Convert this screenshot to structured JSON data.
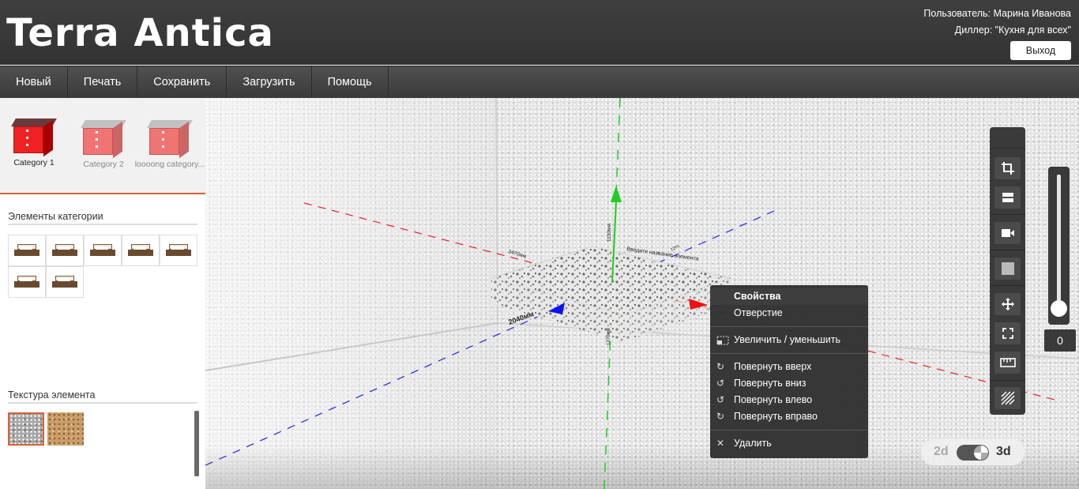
{
  "app": {
    "title": "Terra Antica"
  },
  "header": {
    "user_line": "Пользователь: Марина Иванова",
    "dealer_line": "Диллер: \"Кухня для всех\"",
    "logout_label": "Выход"
  },
  "menu": {
    "items": [
      {
        "label": "Новый"
      },
      {
        "label": "Печать"
      },
      {
        "label": "Сохранить"
      },
      {
        "label": "Загрузить"
      },
      {
        "label": "Помощь"
      }
    ]
  },
  "sidebar": {
    "categories": [
      {
        "label": "Category 1",
        "selected": true
      },
      {
        "label": "Category 2",
        "selected": false
      },
      {
        "label": "loooong category...",
        "selected": false
      }
    ],
    "elements_title": "Элементы категории",
    "elements_count": 7,
    "texture_title": "Текстура элемента",
    "textures": [
      {
        "name": "granite",
        "selected": true
      },
      {
        "name": "wood",
        "selected": false
      }
    ],
    "collapse_icon": "«"
  },
  "scene": {
    "dim_x": "2040мм",
    "dim_top": "3470мм",
    "dim_height_label": "1130мм",
    "dim_depth_label": "1270мм",
    "dim_small": "12то",
    "element_name_placeholder": "Введите название элемента",
    "axis_colors": {
      "x": "#ff0000",
      "y": "#00cc00",
      "z": "#0000ff"
    }
  },
  "context_menu": {
    "items": [
      {
        "label": "Свойства",
        "icon": "",
        "active": true
      },
      {
        "label": "Отверстие",
        "icon": ""
      },
      {
        "label": "Увеличить / уменьшить",
        "icon": "resize-icon",
        "sep_before": true
      },
      {
        "label": "Повернуть вверх",
        "icon": "rotate-icon",
        "sep_before": true
      },
      {
        "label": "Повернуть вниз",
        "icon": "rotate-icon"
      },
      {
        "label": "Повернуть влево",
        "icon": "rotate-icon"
      },
      {
        "label": "Повернуть вправо",
        "icon": "rotate-icon"
      },
      {
        "label": "Удалить",
        "icon": "close-icon",
        "sep_before": true
      }
    ]
  },
  "toolbar": {
    "tools": [
      "crop-icon",
      "layers-icon",
      "camera-icon",
      "square-icon",
      "move-icon",
      "fullscreen-icon",
      "ruler-icon",
      "hatch-icon"
    ]
  },
  "zoom": {
    "value": "0"
  },
  "view_mode": {
    "label_2d": "2d",
    "label_3d": "3d",
    "current": "3d"
  }
}
